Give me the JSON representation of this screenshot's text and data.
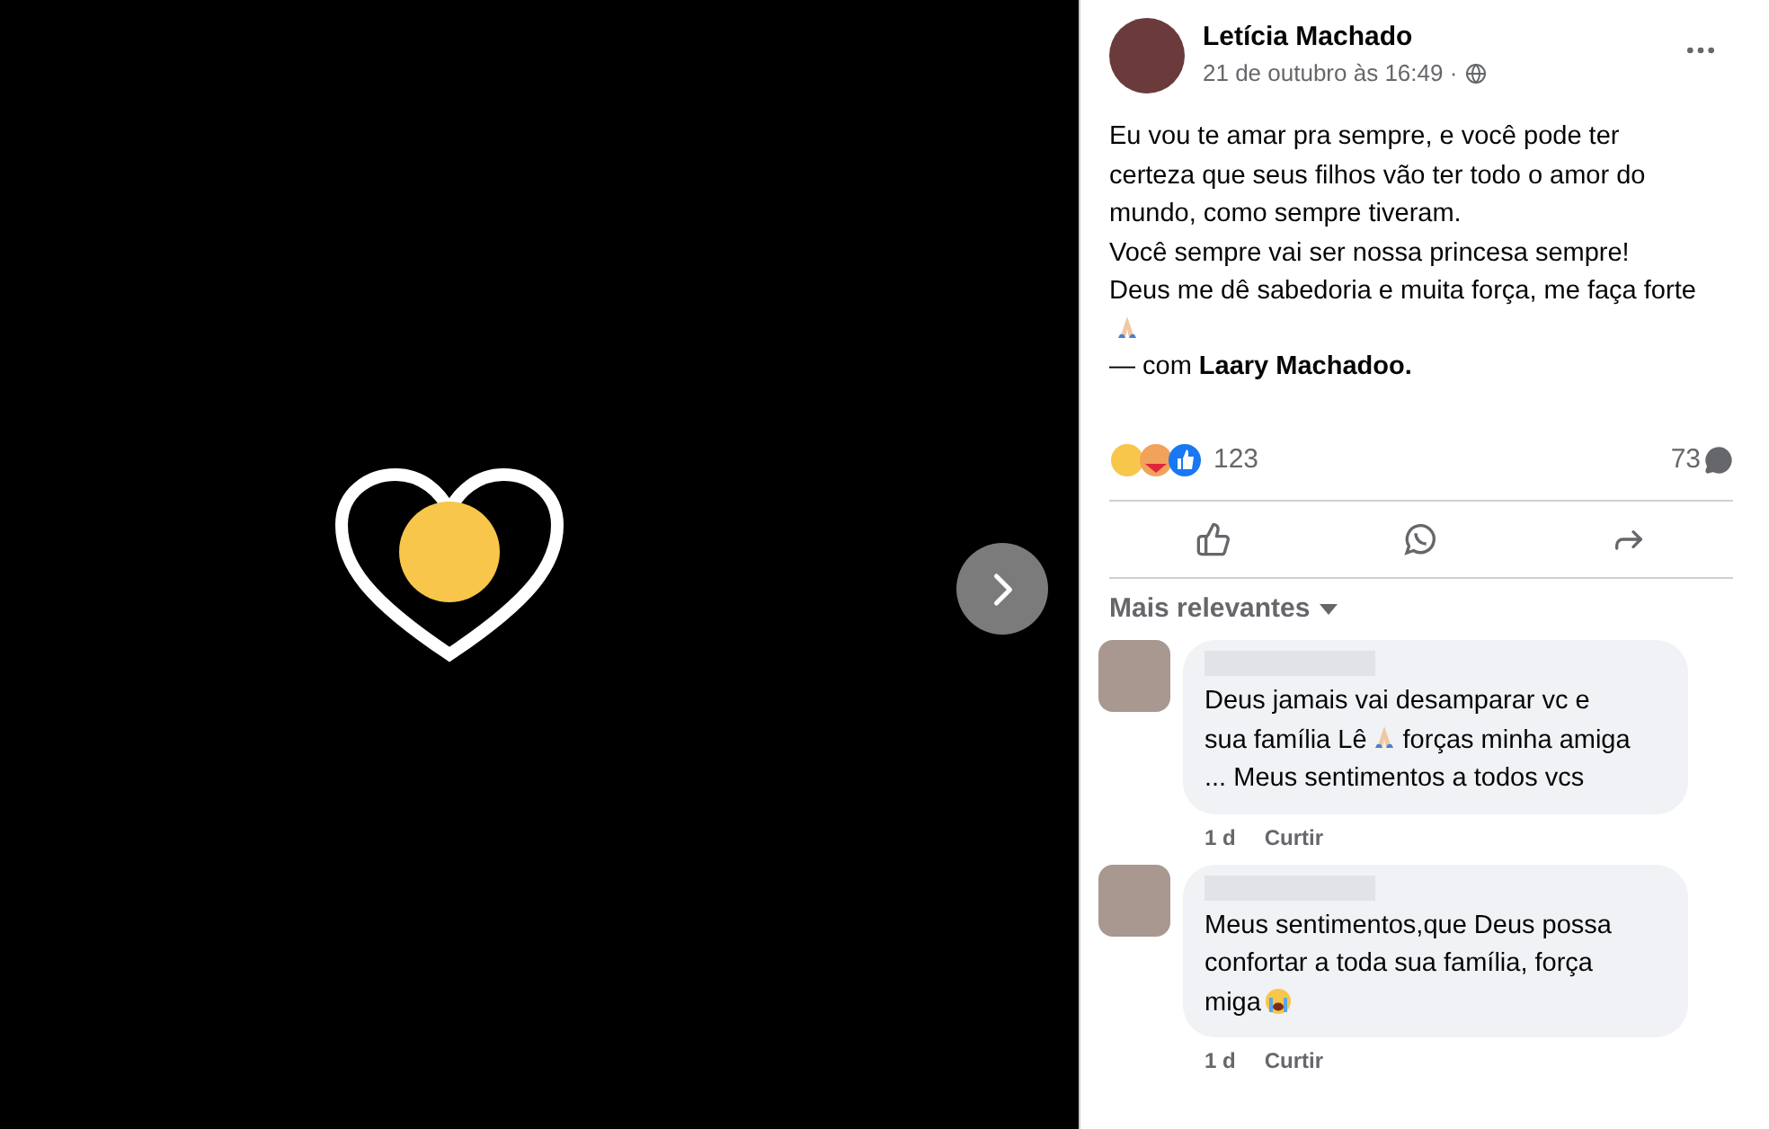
{
  "post": {
    "author": "Letícia Machado",
    "time": "21 de outubro às 16:49 ·",
    "body": [
      "Eu vou te amar pra sempre, e você pode ter certeza que seus filhos vão ter todo o amor do mundo, como sempre tiveram.",
      "Você sempre vai ser nossa princesa sempre!",
      "Deus me dê sabedoria e muita força, me faça forte"
    ],
    "with_prefix": "— com",
    "with_name": "Laary Machadoo."
  },
  "reactions": {
    "count": "123",
    "comments": "73"
  },
  "sort": {
    "label": "Mais relevantes"
  },
  "comments": [
    {
      "parts": [
        "Deus jamais vai desamparar vc e sua família Lê",
        "forças minha amiga ... Meus sentimentos a todos vcs"
      ],
      "kind": "pray",
      "time": "1 d",
      "like": "Curtir"
    },
    {
      "parts": [
        "Meus sentimentos,que Deus possa confortar a toda sua família, força miga"
      ],
      "kind": "cry",
      "time": "1 d",
      "like": "Curtir"
    }
  ]
}
